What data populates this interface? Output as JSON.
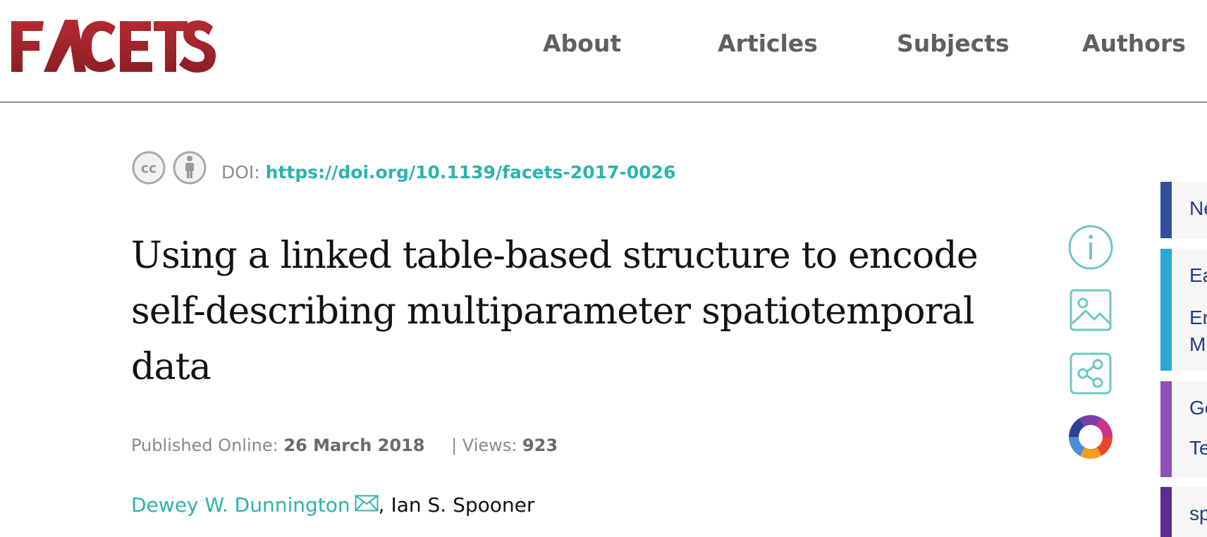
{
  "header": {
    "logo_text": "FACETS",
    "nav": [
      "About",
      "Articles",
      "Subjects",
      "Authors"
    ]
  },
  "article": {
    "license_icons": [
      "creative-commons-icon",
      "attribution-icon"
    ],
    "doi_label": "DOI: ",
    "doi_link": "https://doi.org/10.1139/facets-2017-0026",
    "title": "Using a linked table-based structure to encode self-describing multiparameter spatiotemporal data",
    "published_label": "Published Online: ",
    "published_date": "26 March 2018",
    "views_label": "| Views: ",
    "views": "923",
    "author_1": "Dewey W. Dunnington",
    "author_separator": ", ",
    "author_2": "Ian S. Spooner"
  },
  "tools": [
    "info-icon",
    "figures-icon",
    "share-icon",
    "altmetric-icon"
  ],
  "side_panel": {
    "cards": [
      {
        "lines": [
          "Ne"
        ],
        "color": "#2f4f9c"
      },
      {
        "lines": [
          "Ea",
          "En",
          "M"
        ],
        "color": "#29a9d4"
      },
      {
        "lines": [
          "Ge",
          "Te"
        ],
        "color": "#8f4fb8"
      },
      {
        "lines": [
          "sp"
        ],
        "color": "#5b2d8c"
      }
    ]
  },
  "colors": {
    "brand": "#a8262d",
    "link": "#2bb3ad",
    "title": "#111111",
    "muted": "#8a8a8a"
  }
}
